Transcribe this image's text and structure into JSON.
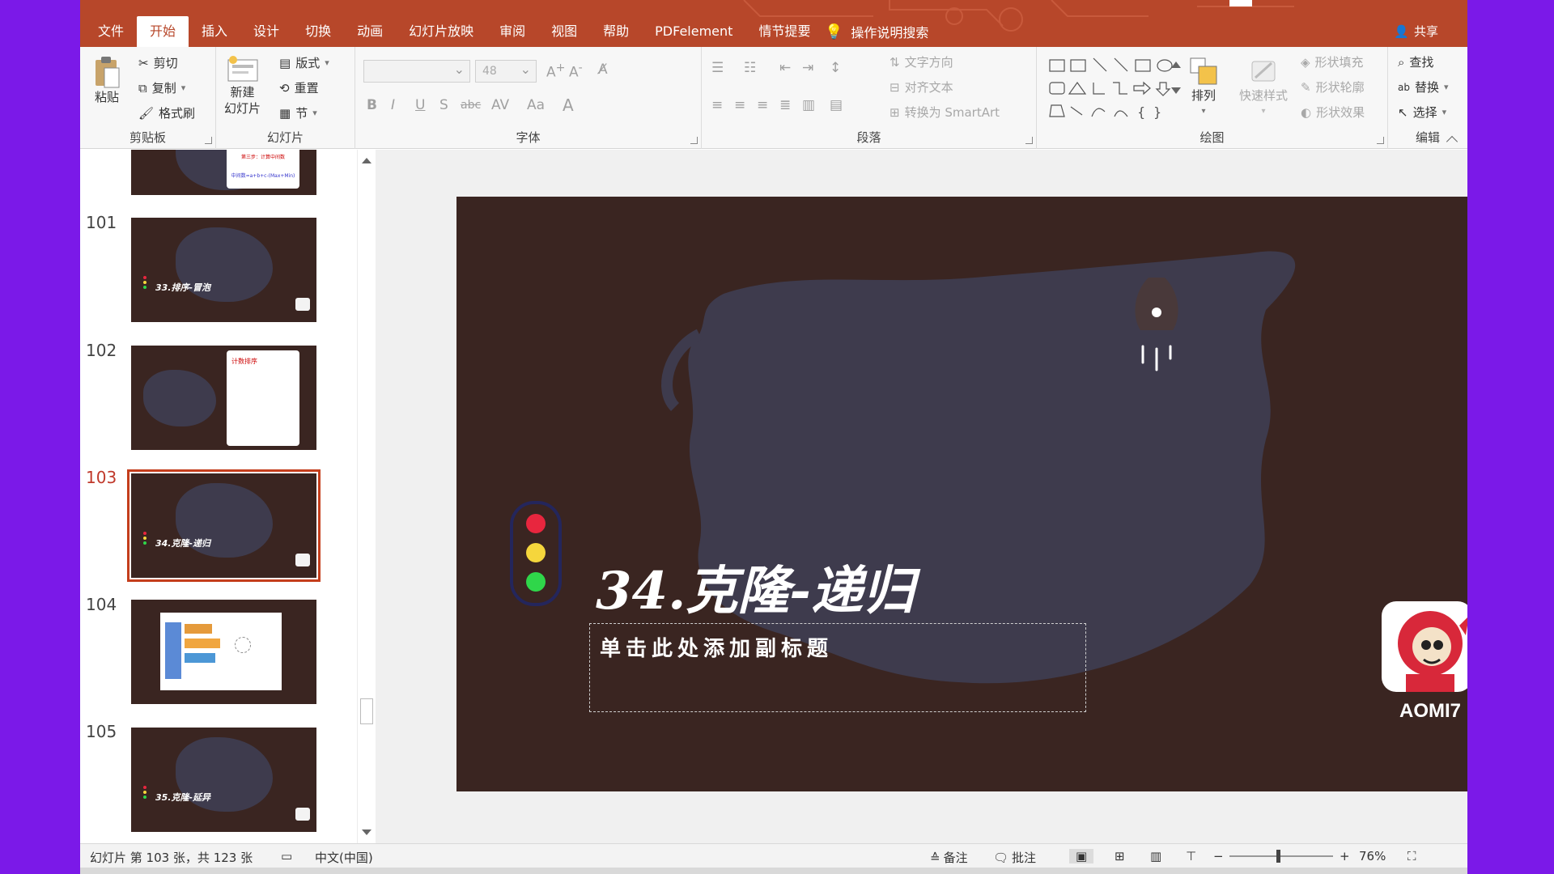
{
  "tabs": [
    "文件",
    "开始",
    "插入",
    "设计",
    "切换",
    "动画",
    "幻灯片放映",
    "审阅",
    "视图",
    "帮助",
    "PDFelement",
    "情节提要"
  ],
  "active_tab": "开始",
  "tell_me": "操作说明搜索",
  "share": "共享",
  "ribbon": {
    "clipboard": {
      "label": "剪贴板",
      "paste": "粘贴",
      "cut": "剪切",
      "copy": "复制",
      "format_painter": "格式刷"
    },
    "slides": {
      "label": "幻灯片",
      "new_slide_line1": "新建",
      "new_slide_line2": "幻灯片",
      "layout": "版式",
      "reset": "重置",
      "section": "节"
    },
    "font": {
      "label": "字体",
      "font_name": "",
      "font_size": "48"
    },
    "paragraph": {
      "label": "段落",
      "text_direction": "文字方向",
      "align_text": "对齐文本",
      "smartart": "转换为 SmartArt"
    },
    "drawing": {
      "label": "绘图",
      "arrange": "排列",
      "quick_styles": "快速样式",
      "shape_fill": "形状填充",
      "shape_outline": "形状轮廓",
      "shape_effects": "形状效果"
    },
    "editing": {
      "label": "编辑",
      "find": "查找",
      "replace": "替换",
      "select": "选择"
    }
  },
  "thumbnails": [
    {
      "number": "",
      "title": "",
      "kind": "card"
    },
    {
      "number": "101",
      "title": "33.排序-冒泡",
      "kind": "section"
    },
    {
      "number": "102",
      "title": "",
      "kind": "card"
    },
    {
      "number": "103",
      "title": "34.克隆-递归",
      "kind": "section",
      "selected": true
    },
    {
      "number": "104",
      "title": "",
      "kind": "screenshot"
    },
    {
      "number": "105",
      "title": "35.克隆-延异",
      "kind": "section"
    }
  ],
  "thumb_card_texts": {
    "card0_line1": "第三步：计算中间数",
    "card0_line2": "中间数=a+b+c-(Max+Min)",
    "card2_title": "计数排序"
  },
  "slide": {
    "title": "34.克隆-递归",
    "subtitle_placeholder": "单击此处添加副标题",
    "logo_text": "AOMI7",
    "traffic_light_colors": [
      "#e8263e",
      "#f5d63c",
      "#2fd64a"
    ]
  },
  "status": {
    "slide_info": "幻灯片 第 103 张，共 123 张",
    "language": "中文(中国)",
    "notes": "备注",
    "comments": "批注",
    "zoom": "76%"
  },
  "colors": {
    "accent": "#b7472a",
    "slide_bg": "#3a2521",
    "brush": "#3e3b4d"
  }
}
